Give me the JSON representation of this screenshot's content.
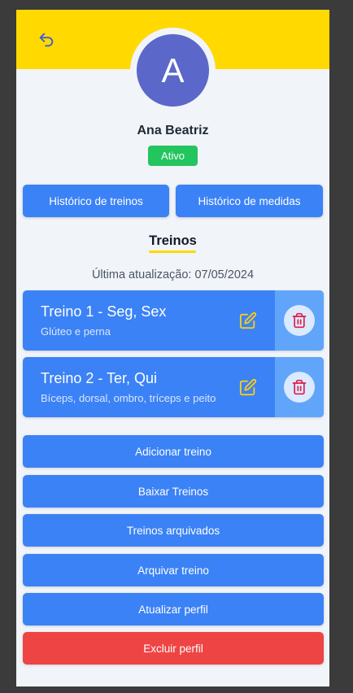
{
  "profile": {
    "avatar_initial": "A",
    "name": "Ana Beatriz",
    "status": "Ativo"
  },
  "nav": {
    "back_icon": "undo-arrow-icon"
  },
  "history_buttons": {
    "workouts": "Histórico de treinos",
    "measures": "Histórico de medidas"
  },
  "workouts_section": {
    "title": "Treinos",
    "last_update": "Última atualização: 07/05/2024"
  },
  "workouts": [
    {
      "title": "Treino 1 - Seg, Sex",
      "subtitle": "Glúteo e perna",
      "edit_icon": "pencil-icon",
      "delete_icon": "trash-icon"
    },
    {
      "title": "Treino 2 - Ter, Qui",
      "subtitle": "Bíceps, dorsal, ombro, tríceps e peito",
      "edit_icon": "pencil-icon",
      "delete_icon": "trash-icon"
    }
  ],
  "actions": {
    "add": "Adicionar treino",
    "download": "Baixar Treinos",
    "archived": "Treinos arquivados",
    "archive": "Arquivar treino",
    "update_profile": "Atualizar perfil",
    "delete_profile": "Excluir perfil"
  },
  "colors": {
    "header": "#ffd900",
    "primary": "#3b82f6",
    "success": "#22c55e",
    "danger": "#ef4444",
    "avatar": "#5b67c9"
  }
}
